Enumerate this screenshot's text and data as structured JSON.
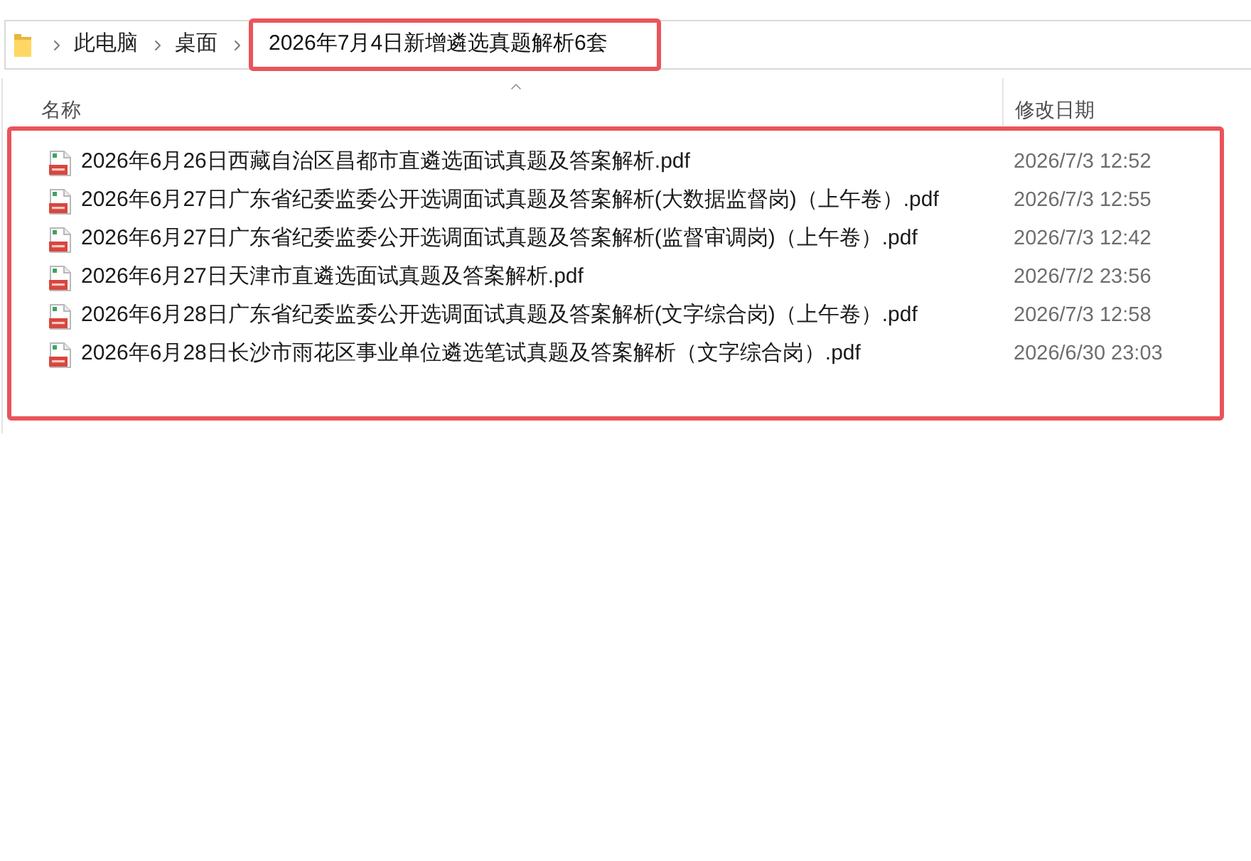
{
  "address_bar": {
    "path": [
      {
        "label": "此电脑",
        "highlighted": false
      },
      {
        "label": "桌面",
        "highlighted": false
      },
      {
        "label": "2026年7月4日新增遴选真题解析6套",
        "highlighted": true
      }
    ]
  },
  "columns": [
    {
      "label": "名称",
      "sorted": true
    },
    {
      "label": "修改日期",
      "sorted": false
    }
  ],
  "file_list": {
    "highlighted": true,
    "files": [
      {
        "name": "2026年6月26日西藏自治区昌都市直遴选面试真题及答案解析.pdf",
        "modified": "2026/7/3 12:52"
      },
      {
        "name": "2026年6月27日广东省纪委监委公开选调面试真题及答案解析(大数据监督岗)（上午卷）.pdf",
        "modified": "2026/7/3 12:55"
      },
      {
        "name": "2026年6月27日广东省纪委监委公开选调面试真题及答案解析(监督审调岗)（上午卷）.pdf",
        "modified": "2026/7/3 12:42"
      },
      {
        "name": "2026年6月27日天津市直遴选面试真题及答案解析.pdf",
        "modified": "2026/7/2 23:56"
      },
      {
        "name": "2026年6月28日广东省纪委监委公开选调面试真题及答案解析(文字综合岗)（上午卷）.pdf",
        "modified": "2026/7/3 12:58"
      },
      {
        "name": "2026年6月28日长沙市雨花区事业单位遴选笔试真题及答案解析（文字综合岗）.pdf",
        "modified": "2026/6/30 23:03"
      }
    ]
  }
}
